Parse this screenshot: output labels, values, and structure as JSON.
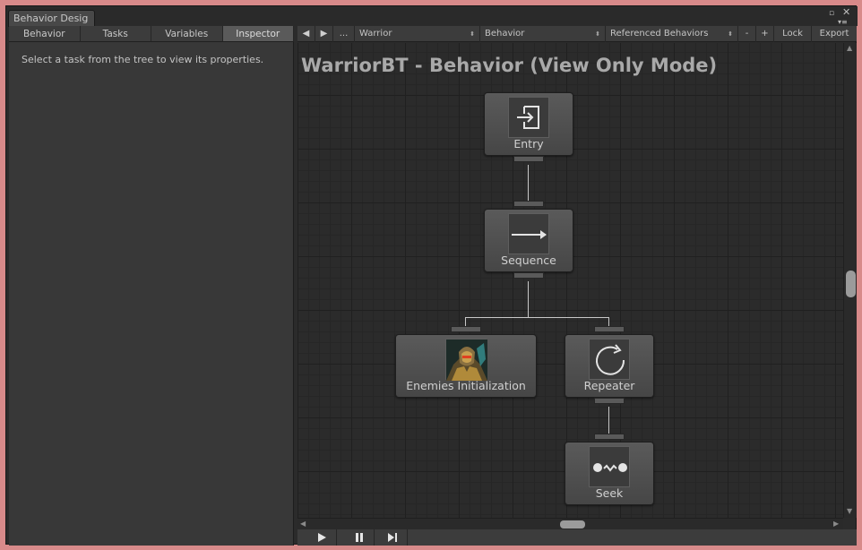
{
  "window": {
    "tab_title": "Behavior Desig"
  },
  "left_panel": {
    "tabs": [
      {
        "label": "Behavior",
        "active": false
      },
      {
        "label": "Tasks",
        "active": false
      },
      {
        "label": "Variables",
        "active": false
      },
      {
        "label": "Inspector",
        "active": true
      }
    ],
    "hint": "Select a task from the tree to view its properties."
  },
  "toolbar": {
    "back_icon": "triangle-left-icon",
    "forward_icon": "triangle-right-icon",
    "more_label": "...",
    "object_select": "Warrior",
    "behavior_select": "Behavior",
    "referenced_select": "Referenced Behaviors",
    "minus_label": "-",
    "plus_label": "+",
    "lock_label": "Lock",
    "export_label": "Export"
  },
  "graph": {
    "title": "WarriorBT - Behavior (View Only Mode)",
    "nodes": {
      "entry": {
        "label": "Entry",
        "icon": "entry-icon"
      },
      "sequence": {
        "label": "Sequence",
        "icon": "arrow-right-icon"
      },
      "enemies": {
        "label": "Enemies Initialization",
        "icon": "warrior-portrait-icon"
      },
      "repeater": {
        "label": "Repeater",
        "icon": "repeat-icon"
      },
      "seek": {
        "label": "Seek",
        "icon": "seek-icon"
      }
    }
  },
  "colors": {
    "background_border": "#d88a8a",
    "panel": "#383838",
    "canvas": "#2b2b2b",
    "node": "#515151",
    "connection": "#c8c8c8"
  }
}
